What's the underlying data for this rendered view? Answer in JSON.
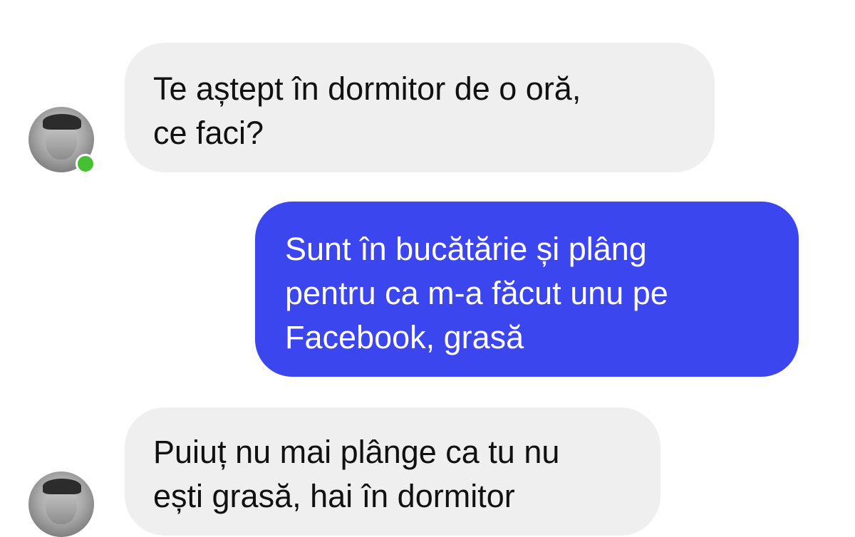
{
  "messages": [
    {
      "direction": "incoming",
      "text": "Te aștept în dormitor de o oră,\nce faci?"
    },
    {
      "direction": "outgoing",
      "text": "Sunt în bucătărie și plâng\npentru ca m-a făcut unu pe\nFacebook, grasă"
    },
    {
      "direction": "incoming",
      "text": "Puiuț nu mai plânge ca tu nu\nești grasă, hai în dormitor"
    }
  ],
  "contact": {
    "online": true
  },
  "colors": {
    "incoming_bubble": "#efefef",
    "outgoing_bubble": "#3b46ee",
    "online_indicator": "#44c033"
  }
}
